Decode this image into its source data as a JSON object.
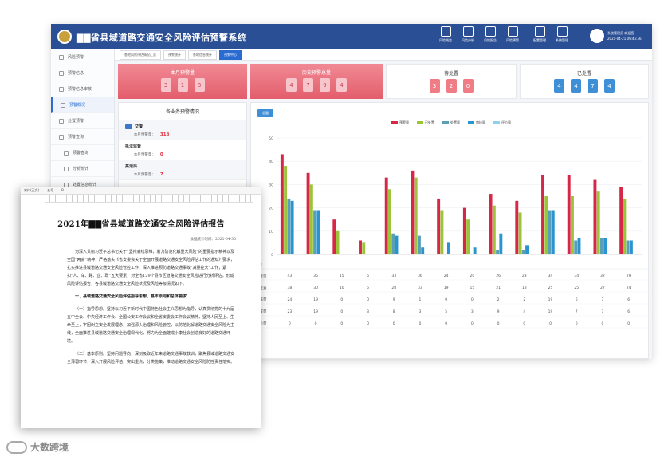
{
  "app": {
    "title": "▇▇省县域道路交通安全风险评估预警系统",
    "nav": [
      {
        "label": "风险概览",
        "icon": "briefcase-icon"
      },
      {
        "label": "风险分析",
        "icon": "list-icon"
      },
      {
        "label": "风险报告",
        "icon": "bar-chart-icon"
      },
      {
        "label": "风险预警",
        "icon": "alert-icon"
      },
      {
        "label": "配置管理",
        "icon": "sliders-icon"
      },
      {
        "label": "系统管理",
        "icon": "gear-icon"
      }
    ],
    "user": {
      "line1": "系统管理员 欢迎您",
      "line2": "2021-04-21 09:45:36"
    }
  },
  "sidebar": [
    {
      "label": "风险预警",
      "active": false,
      "sub": false
    },
    {
      "label": "预警信息",
      "active": false,
      "sub": false
    },
    {
      "label": "预警信息审核",
      "active": false,
      "sub": false
    },
    {
      "label": "预警概况",
      "active": true,
      "sub": false
    },
    {
      "label": "处置预警",
      "active": false,
      "sub": false
    },
    {
      "label": "预警查询",
      "active": false,
      "sub": false
    },
    {
      "label": "预警查询",
      "active": false,
      "sub": true
    },
    {
      "label": "分析统计",
      "active": false,
      "sub": true
    },
    {
      "label": "处置信息统计",
      "active": false,
      "sub": true
    }
  ],
  "tabs": [
    "各地风险评估情况汇总",
    "预警统计",
    "各地信息统计",
    "预警中心"
  ],
  "cards": [
    {
      "title": "本月预警量",
      "digits": [
        "3",
        "1",
        "8"
      ],
      "style": "pink"
    },
    {
      "title": "历史预警总量",
      "digits": [
        "4",
        "7",
        "9",
        "4"
      ],
      "style": "pink"
    },
    {
      "title": "待处置",
      "digits": [
        "3",
        "2",
        "0"
      ],
      "style": "white-red"
    },
    {
      "title": "已处置",
      "digits": [
        "4",
        "4",
        "7",
        "4"
      ],
      "style": "white-blue"
    }
  ],
  "left_panel": {
    "title": "各业务预警情况",
    "depts": [
      {
        "name": "交警",
        "row_label": "本月预警量：",
        "value": "318",
        "alt": true
      },
      {
        "name": "执法监督",
        "row_label": "本月预警量：",
        "value": "0",
        "alt": false
      },
      {
        "name": "高速局",
        "row_label": "本月预警量：",
        "value": "7",
        "alt": true
      }
    ]
  },
  "chart_panel": {
    "button": "总量"
  },
  "chart_data": {
    "type": "bar",
    "categories": [
      "1",
      "2",
      "3",
      "4",
      "5",
      "6",
      "7",
      "8",
      "9",
      "10",
      "11",
      "12",
      "13"
    ],
    "ylim": [
      0,
      50
    ],
    "yticks": [
      0,
      10,
      20,
      30,
      40,
      50
    ],
    "series": [
      {
        "name": "预警量",
        "color": "#d62846",
        "values": [
          43,
          35,
          15,
          6,
          33,
          36,
          24,
          20,
          26,
          23,
          34,
          34,
          32,
          29
        ]
      },
      {
        "name": "已处置",
        "color": "#9bc43a",
        "values": [
          38,
          30,
          10,
          5,
          28,
          33,
          19,
          15,
          21,
          18,
          25,
          25,
          27,
          24
        ]
      },
      {
        "name": "处置量",
        "color": "#5a9fb8",
        "values": [
          24,
          19,
          0,
          0,
          9,
          8,
          0,
          0,
          2,
          2,
          19,
          6,
          7,
          6
        ]
      },
      {
        "name": "审核量",
        "color": "#2a94d0",
        "values": [
          23,
          19,
          0,
          0,
          8,
          3,
          5,
          3,
          9,
          4,
          19,
          7,
          7,
          6
        ]
      },
      {
        "name": "评价量",
        "color": "#8ed0ee",
        "values": [
          0,
          0,
          0,
          0,
          0,
          0,
          0,
          0,
          0,
          0,
          0,
          0,
          0,
          0
        ]
      }
    ],
    "table_rows": [
      {
        "label": "预警量",
        "values": [
          "43",
          "35",
          "15",
          "6",
          "33",
          "36",
          "24",
          "20",
          "26",
          "23",
          "34",
          "34",
          "32",
          "29"
        ]
      },
      {
        "label": "已处置",
        "values": [
          "38",
          "30",
          "10",
          "5",
          "28",
          "33",
          "19",
          "15",
          "21",
          "18",
          "25",
          "25",
          "27",
          "24"
        ]
      },
      {
        "label": "审核量",
        "values": [
          "24",
          "19",
          "0",
          "0",
          "9",
          "1",
          "0",
          "0",
          "2",
          "2",
          "19",
          "6",
          "7",
          "6"
        ]
      },
      {
        "label": "处置量",
        "values": [
          "23",
          "19",
          "0",
          "3",
          "8",
          "3",
          "5",
          "3",
          "9",
          "4",
          "19",
          "7",
          "7",
          "6"
        ]
      },
      {
        "label": "评价量",
        "values": [
          "0",
          "0",
          "0",
          "0",
          "0",
          "0",
          "0",
          "0",
          "0",
          "0",
          "0",
          "0",
          "0",
          "0"
        ]
      }
    ],
    "header_label": "名称"
  },
  "document": {
    "toolbar": [
      "宋体(正文)",
      "五号",
      "B"
    ],
    "title": "2021年▇▇省县域道路交通安全风险评估报告",
    "date": "数据统计时间：2021-04-30",
    "paragraphs": [
      "为深入贯彻习近平总书记关于“坚持底线思维，着力防范化解重大风险”的重要指示精神以及全国“两会”精神，严格落实《省安委会关于全面开展道路交通安全风险评估工作的通知》要求，扎实推进县域道路交通安全风险管控工作，深入推进预防道路交通事故“减量控大”工作，紧扣“人、车、路、企、政”五大要素，对全省129个县市区道路交通安全风险进行分析评估，形成风险评估报告，各县域道路交通安全风险状况及风险等级情况如下。",
      "一、县域道路交通安全风险评估指导思想、基本原则和总体要求",
      "（一）指导思想。坚持以习近平新时代中国特色社会主义思想为指导，认真贯彻党的十九届五中全会、中央经济工作会、全国公安工作会议和全省安委会工作会议精神，坚持人民至上、生命至上，牢固树立安全发展理念，加强源头治理和风险管控，以防范化解道路交通安全风险为主线，全面推进县域道路交通安全治理现代化，努力为全面建成小康社会创造良好的道路交通环境。",
      "（二）基本原则。坚持问题导向，深刻吸取近年来道路交通事故教训，聚焦县域道路交通安全薄弱环节，深入开展风险评估，突出重点，分类施策，推动道路交通安全风险防控责任落实。"
    ]
  },
  "watermark": "大数跨境"
}
